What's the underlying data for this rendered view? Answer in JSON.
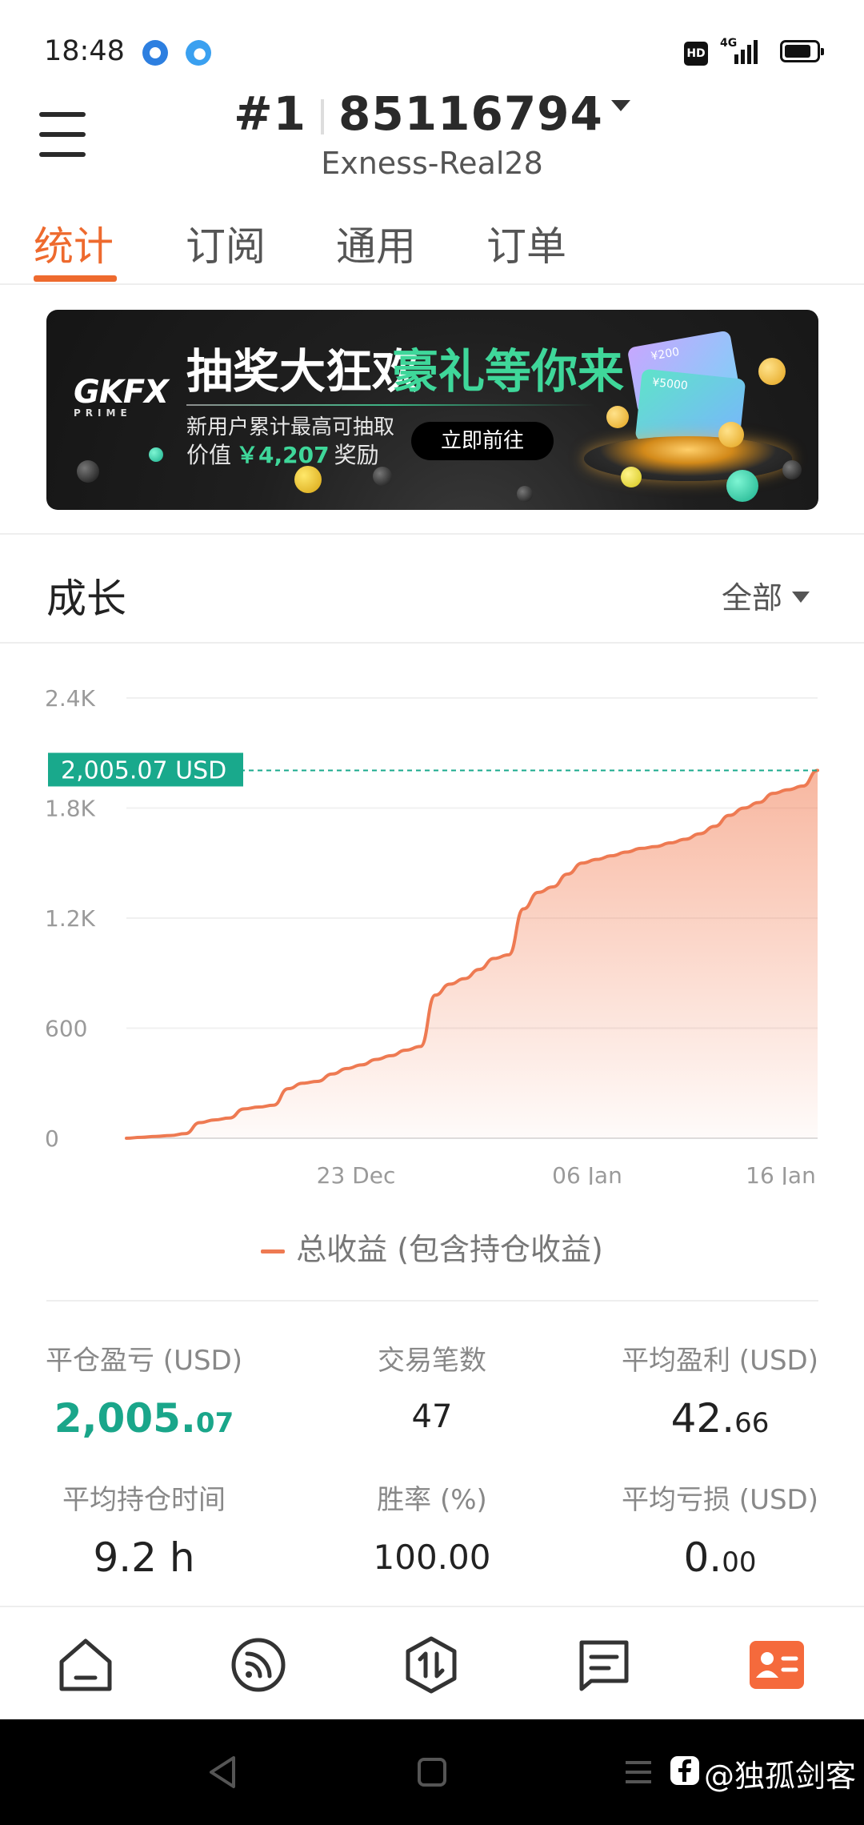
{
  "status_bar": {
    "time": "18:48",
    "signal": "4G",
    "hd": "HD",
    "icons": [
      "notification-app-icon",
      "browser-app-icon",
      "hd-icon",
      "signal-icon",
      "battery-icon"
    ]
  },
  "header": {
    "account_prefix": "#1",
    "account_number": "85116794",
    "server": "Exness-Real28"
  },
  "tabs": [
    {
      "label": "统计",
      "active": true
    },
    {
      "label": "订阅",
      "active": false
    },
    {
      "label": "通用",
      "active": false
    },
    {
      "label": "订单",
      "active": false
    }
  ],
  "banner": {
    "logo": "GKFX",
    "logo_sub": "PRIME",
    "title_white": "抽奖大狂欢",
    "title_green": "豪礼等你来",
    "subtitle_line1": "新用户累计最高可抽取",
    "subtitle_prefix": "价值",
    "subtitle_amount": "￥4,207",
    "subtitle_suffix": "奖励",
    "cta": "立即前往",
    "card_label_1": "¥200",
    "card_label_2": "¥5000"
  },
  "growth": {
    "title": "成长",
    "range": "全部"
  },
  "chart_data": {
    "type": "area",
    "current_label": "2,005.07 USD",
    "current_value": 2005.07,
    "ylim": [
      0,
      2400
    ],
    "y_ticks": [
      {
        "value": 0,
        "label": "0"
      },
      {
        "value": 600,
        "label": "600"
      },
      {
        "value": 1200,
        "label": "1.2K"
      },
      {
        "value": 1800,
        "label": "1.8K"
      },
      {
        "value": 2400,
        "label": "2.4K"
      }
    ],
    "x_ticks": [
      "23 Dec",
      "06 Jan",
      "16 Jan"
    ],
    "series": [
      {
        "name": "总收益 (包含持仓收益)",
        "color": "#ee7a52",
        "values": [
          0,
          5,
          10,
          15,
          25,
          85,
          100,
          110,
          160,
          170,
          180,
          270,
          300,
          310,
          350,
          380,
          400,
          430,
          450,
          480,
          500,
          780,
          840,
          870,
          920,
          980,
          1000,
          1250,
          1340,
          1370,
          1440,
          1500,
          1520,
          1540,
          1560,
          1580,
          1590,
          1610,
          1630,
          1660,
          1700,
          1760,
          1800,
          1830,
          1880,
          1900,
          1920,
          2005.07
        ]
      }
    ],
    "reference_color": "#19a98c"
  },
  "stats": [
    {
      "label": "平仓盈亏 (USD)",
      "int": "2,005.",
      "dec": "07",
      "highlight": true
    },
    {
      "label": "交易笔数",
      "int": "47",
      "dec": "",
      "highlight": false
    },
    {
      "label": "平均盈利 (USD)",
      "int": "42.",
      "dec": "66",
      "highlight": false
    },
    {
      "label": "平均持仓时间",
      "int": "9.2 h",
      "dec": "",
      "highlight": false
    },
    {
      "label": "胜率 (%)",
      "int": "100.00",
      "dec": "",
      "highlight": false
    },
    {
      "label": "平均亏损 (USD)",
      "int": "0.",
      "dec": "00",
      "highlight": false
    }
  ],
  "bottom_nav": [
    "home-icon",
    "broadcast-icon",
    "trade-icon",
    "messages-icon",
    "profile-icon"
  ],
  "watermark": "@独孤剑客"
}
